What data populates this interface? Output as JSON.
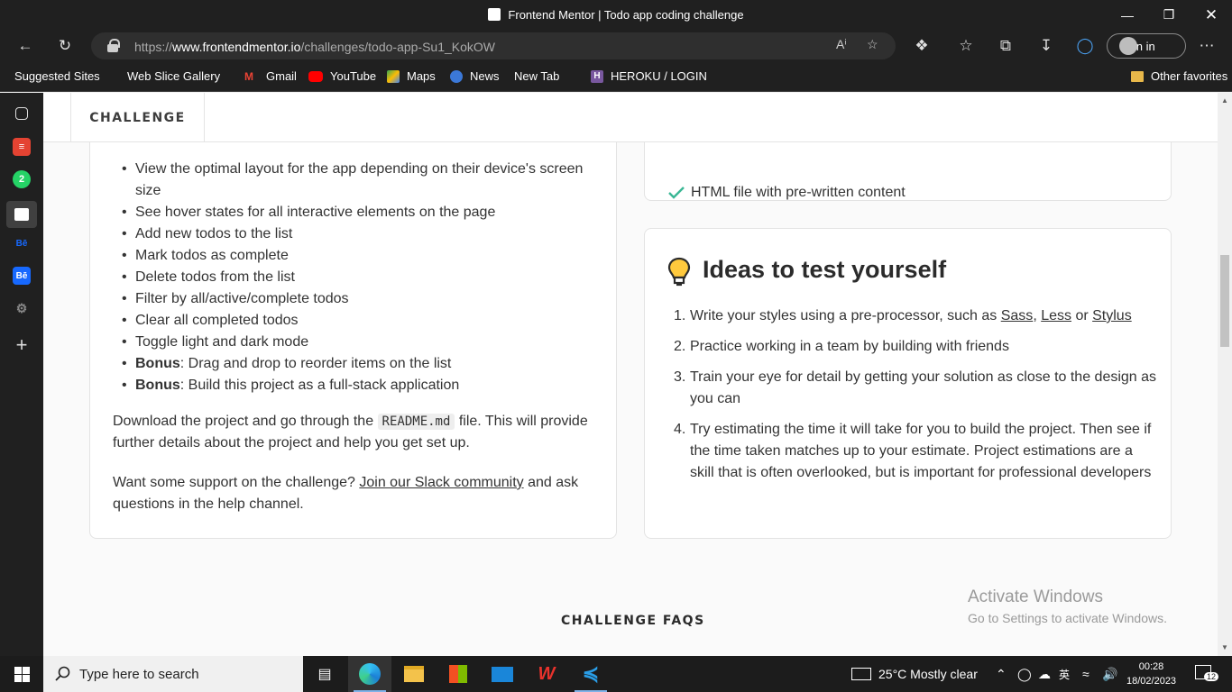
{
  "window": {
    "title": "Frontend Mentor | Todo app coding challenge"
  },
  "browser": {
    "url_prefix": "https://",
    "url_domain": "www.frontendmentor.io",
    "url_path": "/challenges/todo-app-Su1_KokOW",
    "signin_label": "Sign in",
    "favorites": [
      {
        "label": "Suggested Sites"
      },
      {
        "label": "Web Slice Gallery"
      },
      {
        "label": "Gmail"
      },
      {
        "label": "YouTube"
      },
      {
        "label": "Maps"
      },
      {
        "label": "News"
      },
      {
        "label": "New Tab"
      },
      {
        "label": "HEROKU / LOGIN"
      }
    ],
    "other_favorites": "Other favorites"
  },
  "page": {
    "tab_label": "CHALLENGE",
    "features": [
      {
        "bold": "",
        "text": "View the optimal layout for the app depending on their device's screen size"
      },
      {
        "bold": "",
        "text": "See hover states for all interactive elements on the page"
      },
      {
        "bold": "",
        "text": "Add new todos to the list"
      },
      {
        "bold": "",
        "text": "Mark todos as complete"
      },
      {
        "bold": "",
        "text": "Delete todos from the list"
      },
      {
        "bold": "",
        "text": "Filter by all/active/complete todos"
      },
      {
        "bold": "",
        "text": "Clear all completed todos"
      },
      {
        "bold": "",
        "text": "Toggle light and dark mode"
      },
      {
        "bold": "Bonus",
        "text": ": Drag and drop to reorder items on the list"
      },
      {
        "bold": "Bonus",
        "text": ": Build this project as a full-stack application"
      }
    ],
    "download_para": {
      "before": "Download the project and go through the ",
      "code": "README.md",
      "after": " file. This will provide further details about the project and help you get set up."
    },
    "support_para": {
      "before": "Want some support on the challenge? ",
      "link": "Join our Slack community",
      "after": " and ask questions in the help channel."
    },
    "starter_item": "HTML file with pre-written content",
    "ideas_title": "Ideas to test yourself",
    "ideas": {
      "item1_before": "Write your styles using a pre-processor, such as ",
      "item1_link1": "Sass",
      "item1_sep1": ", ",
      "item1_link2": "Less",
      "item1_sep2": " or ",
      "item1_link3": "Stylus",
      "item2": "Practice working in a team by building with friends",
      "item3": "Train your eye for detail by getting your solution as close to the design as you can",
      "item4": "Try estimating the time it will take for you to build the project. Then see if the time taken matches up to your estimate. Project estimations are a skill that is often overlooked, but is important for professional developers"
    },
    "faq_title": "CHALLENGE FAQS",
    "watermark_line1": "Activate Windows",
    "watermark_line2": "Go to Settings to activate Windows."
  },
  "taskbar": {
    "search_placeholder": "Type here to search",
    "weather": "25°C  Mostly clear",
    "time": "00:28",
    "date": "18/02/2023",
    "notifications": "12",
    "ime": "英"
  }
}
